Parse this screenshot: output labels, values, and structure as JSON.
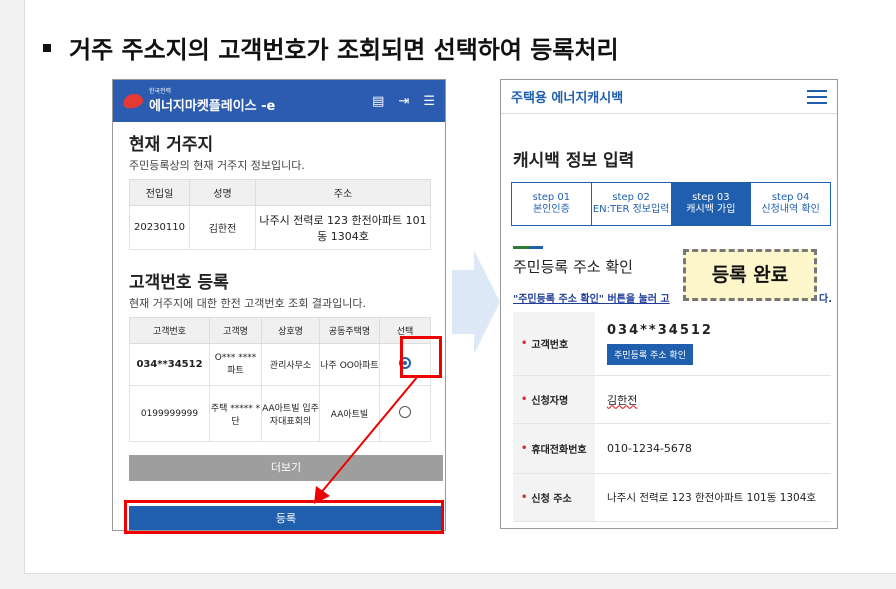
{
  "slide": {
    "heading": "거주 주소지의 고객번호가 조회되면 선택하여 등록처리"
  },
  "left_phone": {
    "brand_small": "한국전력",
    "brand": "에너지마켓플레이스",
    "current_address": {
      "title": "현재 거주지",
      "desc": "주민등록상의 현재 거주지 정보입니다.",
      "headers": [
        "전입일",
        "성명",
        "주소"
      ],
      "row": [
        "20230110",
        "김한전",
        "나주시 전력로 123 한전아파트 101동 1304호"
      ]
    },
    "customer_number": {
      "title": "고객번호 등록",
      "desc": "현재 거주지에 대한 한전 고객번호 조회 결과입니다.",
      "headers": [
        "고객번호",
        "고객명",
        "상호명",
        "공동주택명",
        "선택"
      ],
      "rows": [
        [
          "034**34512",
          "O*** **** 파트",
          "관리사무소",
          "나주 OO아파트"
        ],
        [
          "0199999999",
          "주택 ***** *단",
          "AA아트빌 입주자대표회의",
          "AA아트빌"
        ]
      ]
    },
    "more_label": "더보기",
    "register_label": "등록"
  },
  "right_phone": {
    "title": "주택용 에너지캐시백",
    "heading": "캐시백 정보 입력",
    "steps": [
      {
        "no": "step 01",
        "label": "본인인증"
      },
      {
        "no": "step 02",
        "label": "EN:TER 정보입력"
      },
      {
        "no": "step 03",
        "label": "캐시백 가입"
      },
      {
        "no": "step 04",
        "label": "신청내역 확인"
      }
    ],
    "address_title": "주민등록 주소 확인",
    "note": "\"주민등록 주소 확인\" 버튼을 눌러 고",
    "note_tail": "다.",
    "fields": [
      {
        "label": "고객번호",
        "value": "034**34512",
        "button": "주민등록 주소 확인"
      },
      {
        "label": "신청자명",
        "value": "김한전"
      },
      {
        "label": "휴대전화번호",
        "value": "010-1234-5678"
      },
      {
        "label": "신청 주소",
        "value": "나주시 전력로 123 한전아파트 101동 1304호"
      }
    ]
  },
  "overlay": {
    "done_label": "등록 완료"
  },
  "colors": {
    "brand_blue": "#1f5fae",
    "highlight_red": "#e00000"
  }
}
